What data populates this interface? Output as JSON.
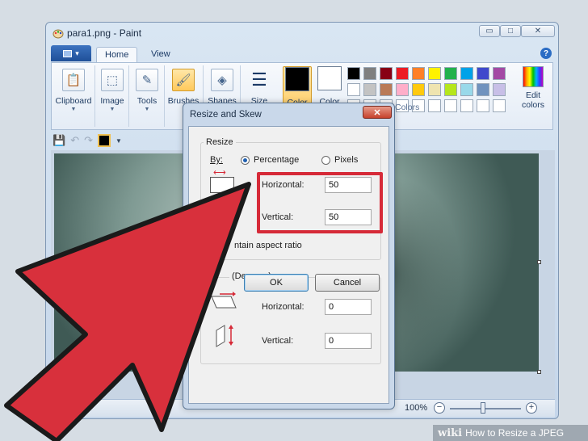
{
  "window": {
    "title": "para1.png - Paint",
    "min_glyph": "▭",
    "max_glyph": "□",
    "close_glyph": "✕"
  },
  "ribbon": {
    "app_menu_glyph": "▾",
    "tabs": [
      {
        "label": "Home"
      },
      {
        "label": "View"
      }
    ],
    "help_glyph": "?",
    "tools": [
      {
        "label": "Clipboard",
        "glyph": "📋"
      },
      {
        "label": "Image",
        "glyph": "⬚"
      },
      {
        "label": "Tools",
        "glyph": "✎"
      },
      {
        "label": "Brushes",
        "glyph": "🖌"
      },
      {
        "label": "Shapes",
        "glyph": "◈"
      },
      {
        "label": "Size",
        "glyph": "☰"
      }
    ],
    "color1_label": "Color\n1",
    "color2_label": "Color\n2",
    "color1_value": "#000000",
    "color2_value": "#ffffff",
    "palette_rows": [
      [
        "#000000",
        "#7f7f7f",
        "#880015",
        "#ed1c24",
        "#ff7f27",
        "#fff200",
        "#22b14c",
        "#00a2e8",
        "#3f48cc",
        "#a349a4"
      ],
      [
        "#ffffff",
        "#c3c3c3",
        "#b97a57",
        "#ffaec9",
        "#ffc90e",
        "#efe4b0",
        "#b5e61d",
        "#99d9ea",
        "#7092be",
        "#c8bfe7"
      ],
      [
        "#ffffff",
        "#ffffff",
        "#ffffff",
        "#ffffff",
        "#ffffff",
        "#ffffff",
        "#ffffff",
        "#ffffff",
        "#ffffff",
        "#ffffff"
      ]
    ],
    "colors_group_label": "Colors",
    "edit_colors_label": "Edit\ncolors"
  },
  "status": {
    "zoom": "100%",
    "minus": "−",
    "plus": "+"
  },
  "dialog": {
    "title": "Resize and Skew",
    "close_glyph": "✕",
    "resize_legend": "Resize",
    "by_label": "By:",
    "percentage_label": "Percentage",
    "pixels_label": "Pixels",
    "horizontal_label": "Horizontal:",
    "horizontal_value": "50",
    "vertical_label": "Vertical:",
    "vertical_value": "50",
    "aspect_label": "ntain aspect ratio",
    "skew_legend": "(Degrees)",
    "skew_horizontal_label": "Horizontal:",
    "skew_horizontal_value": "0",
    "skew_vertical_label": "Vertical:",
    "skew_vertical_value": "0",
    "ok_label": "OK",
    "cancel_label": "Cancel"
  },
  "watermark": {
    "brand": "wiki",
    "text": "How to Resize a JPEG"
  },
  "colors": {
    "highlight": "#d62a38",
    "arrow": "#d8303c",
    "title_bar": "#d9e6f3"
  }
}
